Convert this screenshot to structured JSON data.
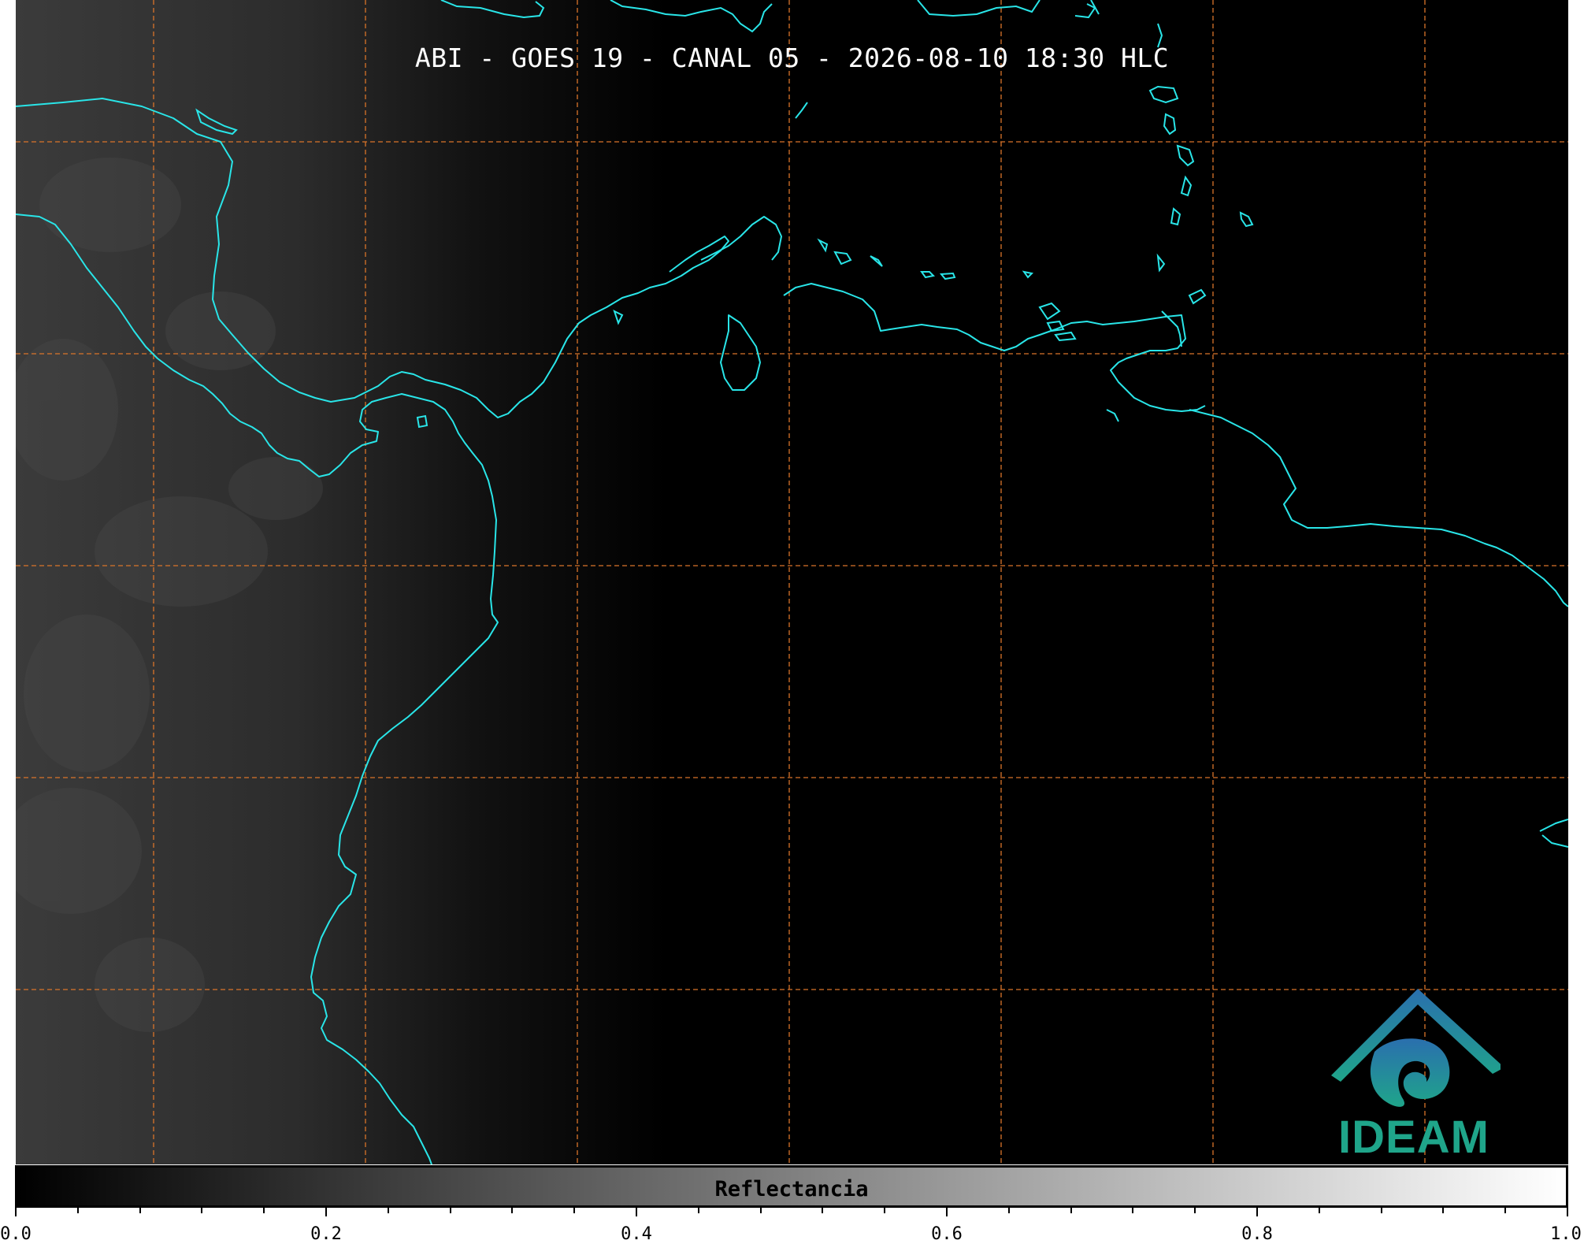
{
  "title": "ABI - GOES 19 - CANAL 05 - 2026-08-10 18:30 HLC",
  "colors": {
    "background": "#000000",
    "coastline": "#29e5e8",
    "grid": "#d9742a",
    "logo_green": "#1fa58a",
    "logo_blue": "#2a6fae"
  },
  "logo": {
    "name": "IDEAM",
    "text": "IDEAM"
  },
  "colorbar": {
    "label": "Reflectancia",
    "range": [
      0.0,
      1.0
    ],
    "ticks": [
      "0.0",
      "0.2",
      "0.4",
      "0.6",
      "0.8",
      "1.0"
    ],
    "colormap": "grayscale"
  },
  "map": {
    "projection": "geostationary",
    "layers": [
      "satellite-reflectance",
      "coastlines",
      "lat-lon-grid"
    ]
  }
}
